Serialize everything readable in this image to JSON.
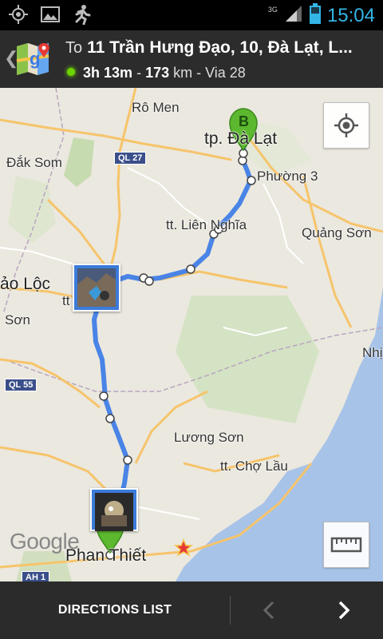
{
  "status_bar": {
    "time": "15:04",
    "network": "3G",
    "icons": [
      "gps-icon",
      "image-notification-icon",
      "running-man-icon",
      "signal-icon",
      "battery-icon"
    ]
  },
  "header": {
    "to_prefix": "To",
    "destination": "11 Trần Hưng Đạo, 10, Đà Lạt, L...",
    "duration_h": "3h",
    "duration_m": "13m",
    "sep1": " - ",
    "distance": "173",
    "distance_unit": " km",
    "via": " - Via 28"
  },
  "map": {
    "labels": {
      "ro_men": "Rô Men",
      "dak_som": "Đắk Som",
      "tp_da_lat": "tp. Đà Lạt",
      "phuong3": "Phường 3",
      "lien_nghia": "tt. Liên Nghĩa",
      "quang_son": "Quảng Sơn",
      "bao_loc": "ảo Lộc",
      "tt": "tt",
      "son": "Sơn",
      "nhi": "Nhị",
      "luong_son": "Lương Sơn",
      "cho_lau": "tt. Chợ Lầu",
      "phan_thiet": "Phan Thiết"
    },
    "shields": {
      "ql27": "QL 27",
      "ql55": "QL 55",
      "ah1": "AH 1"
    },
    "marker_a": "A",
    "marker_b": "B",
    "attribution": "Google",
    "colors": {
      "route": "#3b7be6",
      "marker": "#5cb82e",
      "water": "#a7c3e8",
      "road": "#f6c46b"
    }
  },
  "bottom_bar": {
    "directions_list": "DIRECTIONS LIST"
  }
}
